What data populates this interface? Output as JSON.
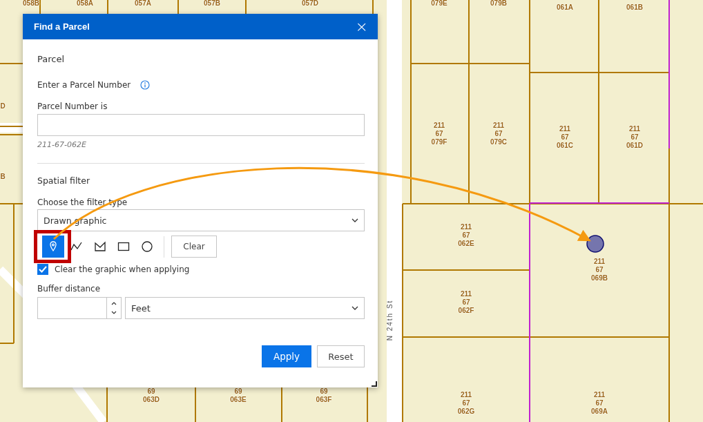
{
  "map": {
    "parcels": [
      {
        "label": "058B"
      },
      {
        "label": "058A"
      },
      {
        "label": "057A"
      },
      {
        "label": "057B"
      },
      {
        "label": "057D"
      },
      {
        "label": "079E"
      },
      {
        "label": "079B"
      },
      {
        "label": "061A"
      },
      {
        "label": "061B"
      },
      {
        "label": "D"
      },
      {
        "label": "B"
      },
      {
        "label": "211\n67\n079F"
      },
      {
        "label": "211\n67\n079C"
      },
      {
        "label": "211\n67\n061C"
      },
      {
        "label": "211\n67\n061D"
      },
      {
        "label": "211\n67\n062E"
      },
      {
        "label": "211\n67\n069B"
      },
      {
        "label": "211\n67\n062F"
      },
      {
        "label": "211\n67\n062G"
      },
      {
        "label": "211\n67\n069A"
      },
      {
        "label": "69\n063D"
      },
      {
        "label": "69\n063E"
      },
      {
        "label": "69\n063F"
      }
    ],
    "street_label": "N 24th St"
  },
  "dialog": {
    "title": "Find a Parcel",
    "close": "×",
    "section": "Parcel",
    "prompt": "Enter a Parcel Number",
    "field_label": "Parcel Number is",
    "field_hint": "211-67-062E",
    "spatial_title": "Spatial filter",
    "filter_type_label": "Choose the filter type",
    "filter_type": "Drawn graphic",
    "tools": [
      {
        "kind": "point",
        "selected": true
      },
      {
        "kind": "polyline",
        "selected": false
      },
      {
        "kind": "polygon",
        "selected": false
      },
      {
        "kind": "rectangle",
        "selected": false
      },
      {
        "kind": "circle",
        "selected": false
      }
    ],
    "clear_button": "Clear",
    "clear_on_apply": {
      "label": "Clear the graphic when applying",
      "checked": true
    },
    "buffer_label": "Buffer distance",
    "buffer_unit": "Feet",
    "buttons": [
      {
        "label": "Apply",
        "kind": "primary"
      },
      {
        "label": "Reset",
        "kind": "secondary"
      }
    ]
  }
}
